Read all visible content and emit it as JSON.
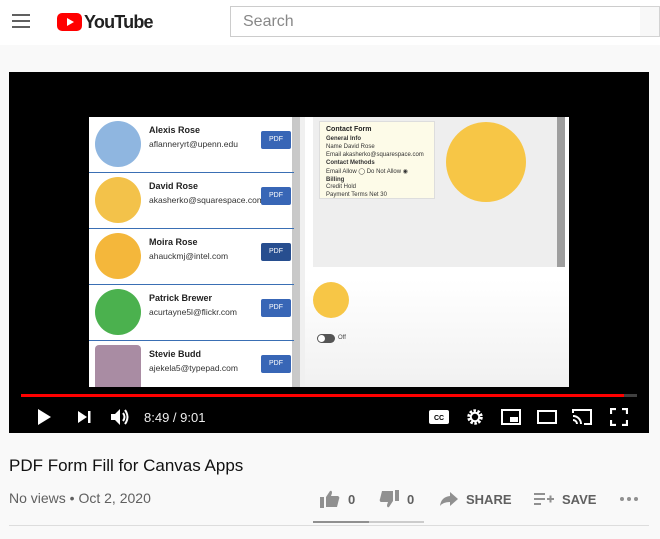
{
  "header": {
    "logo_text": "YouTube",
    "search_placeholder": "Search"
  },
  "player": {
    "time": "8:49 / 9:01",
    "progress": 0.979,
    "screen": {
      "contacts": [
        {
          "name": "Alexis Rose",
          "email": "aflanneryrt@upenn.edu",
          "button": "PDF",
          "color": "#8fb6e0"
        },
        {
          "name": "David Rose",
          "email": "akasherko@squarespace.com",
          "button": "PDF",
          "color": "#f3c24a"
        },
        {
          "name": "Moira Rose",
          "email": "ahauckmj@intel.com",
          "button": "PDF",
          "color": "#f4b73b"
        },
        {
          "name": "Patrick Brewer",
          "email": "acurtayne5l@flickr.com",
          "button": "PDF",
          "color": "#4bb14e"
        },
        {
          "name": "Stevie Budd",
          "email": "ajekela5@typepad.com",
          "button": "PDF",
          "color": "#a98ca3"
        }
      ],
      "form_title": "Contact Form",
      "form_lines": [
        "General Info",
        "Name   David Rose",
        "Email   akasherko@squarespace.com",
        "Contact Methods",
        "Email   Allow  ◯ Do Not Allow ◉",
        "Billing",
        "Credit Hold",
        "Payment Terms  Net 30"
      ],
      "toggle_label": "Off"
    }
  },
  "video": {
    "title": "PDF Form Fill for Canvas Apps",
    "meta": "No views • Oct 2, 2020",
    "likes": "0",
    "dislikes": "0",
    "share_label": "SHARE",
    "save_label": "SAVE",
    "like_ratio": 0.5
  },
  "colors": {
    "brand_red": "#ff0000",
    "pdf_button": "#3866b6"
  }
}
